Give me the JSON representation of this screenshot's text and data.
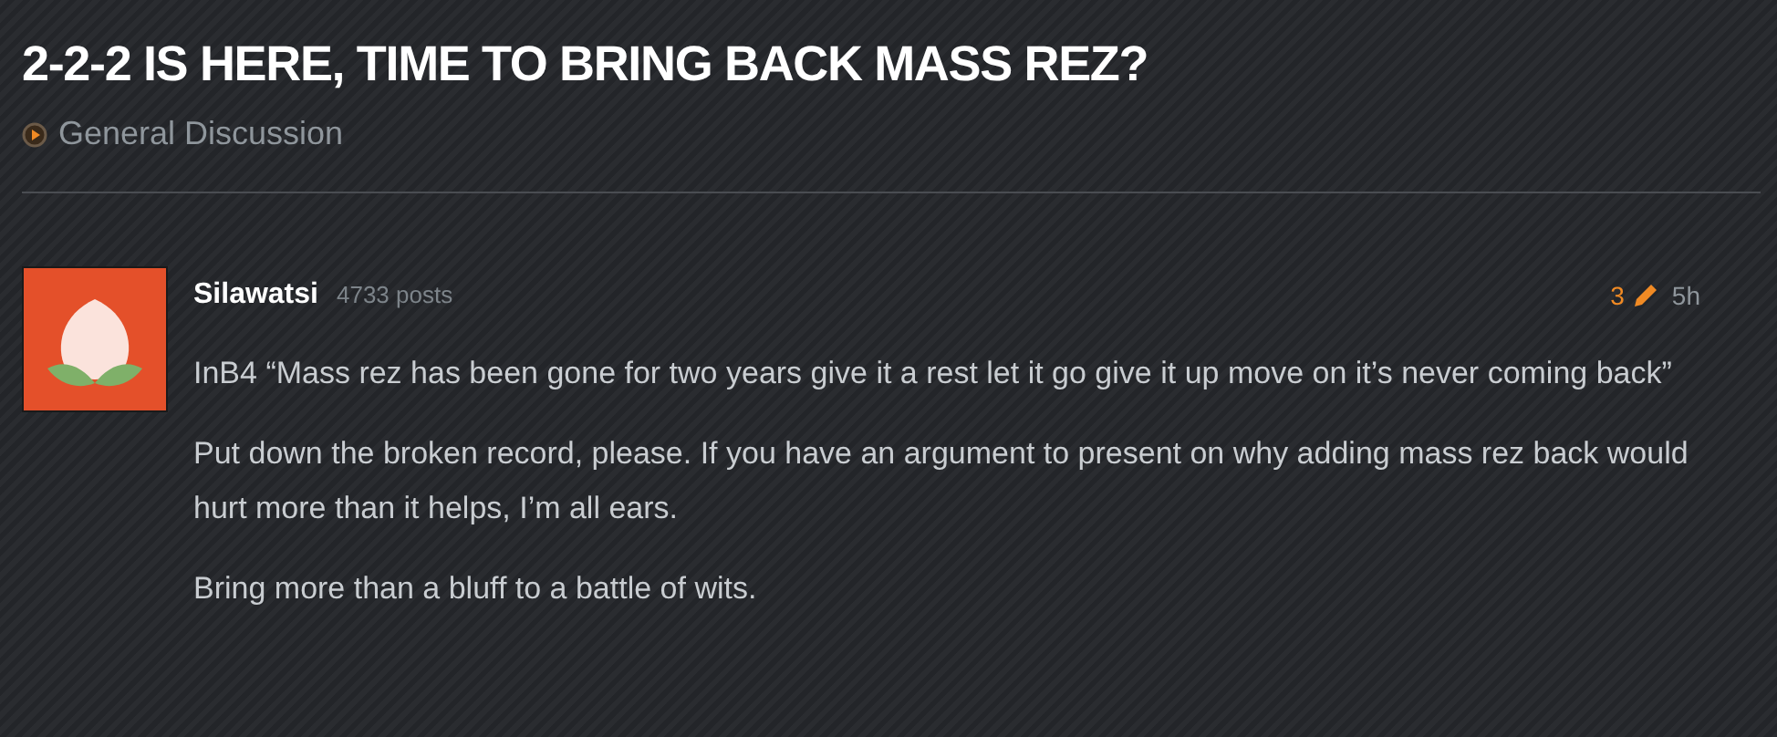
{
  "thread": {
    "title": "2-2-2 IS HERE, TIME TO BRING BACK MASS REZ?",
    "category": "General Discussion"
  },
  "post": {
    "author": "Silawatsi",
    "post_count": "4733 posts",
    "edit_count": "3",
    "time": "5h",
    "paragraphs": [
      "InB4 “Mass rez has been gone for two years give it a rest let it go give it up move on it’s never coming back”",
      "Put down the broken record, please. If you have an argument to present on why adding mass rez back would hurt more than it helps, I’m all ears.",
      "Bring more than a bluff to a battle of wits."
    ]
  }
}
